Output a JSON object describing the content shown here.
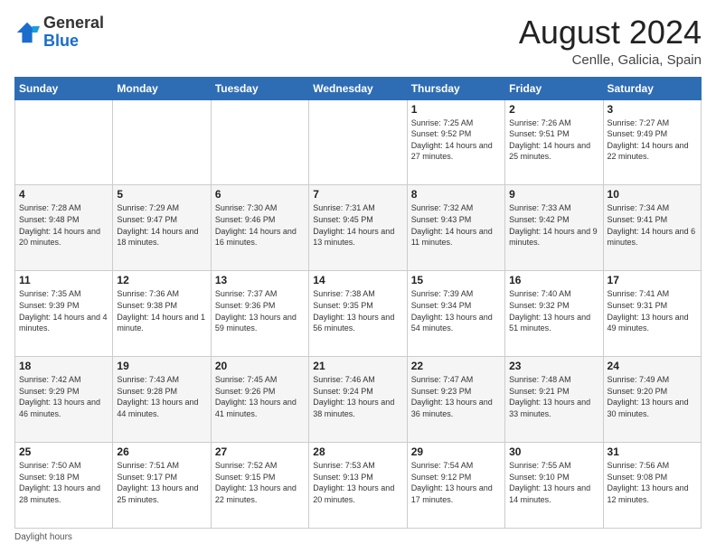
{
  "logo": {
    "general": "General",
    "blue": "Blue"
  },
  "header": {
    "month": "August 2024",
    "location": "Cenlle, Galicia, Spain"
  },
  "days_of_week": [
    "Sunday",
    "Monday",
    "Tuesday",
    "Wednesday",
    "Thursday",
    "Friday",
    "Saturday"
  ],
  "weeks": [
    [
      {
        "day": "",
        "info": ""
      },
      {
        "day": "",
        "info": ""
      },
      {
        "day": "",
        "info": ""
      },
      {
        "day": "",
        "info": ""
      },
      {
        "day": "1",
        "info": "Sunrise: 7:25 AM\nSunset: 9:52 PM\nDaylight: 14 hours and 27 minutes."
      },
      {
        "day": "2",
        "info": "Sunrise: 7:26 AM\nSunset: 9:51 PM\nDaylight: 14 hours and 25 minutes."
      },
      {
        "day": "3",
        "info": "Sunrise: 7:27 AM\nSunset: 9:49 PM\nDaylight: 14 hours and 22 minutes."
      }
    ],
    [
      {
        "day": "4",
        "info": "Sunrise: 7:28 AM\nSunset: 9:48 PM\nDaylight: 14 hours and 20 minutes."
      },
      {
        "day": "5",
        "info": "Sunrise: 7:29 AM\nSunset: 9:47 PM\nDaylight: 14 hours and 18 minutes."
      },
      {
        "day": "6",
        "info": "Sunrise: 7:30 AM\nSunset: 9:46 PM\nDaylight: 14 hours and 16 minutes."
      },
      {
        "day": "7",
        "info": "Sunrise: 7:31 AM\nSunset: 9:45 PM\nDaylight: 14 hours and 13 minutes."
      },
      {
        "day": "8",
        "info": "Sunrise: 7:32 AM\nSunset: 9:43 PM\nDaylight: 14 hours and 11 minutes."
      },
      {
        "day": "9",
        "info": "Sunrise: 7:33 AM\nSunset: 9:42 PM\nDaylight: 14 hours and 9 minutes."
      },
      {
        "day": "10",
        "info": "Sunrise: 7:34 AM\nSunset: 9:41 PM\nDaylight: 14 hours and 6 minutes."
      }
    ],
    [
      {
        "day": "11",
        "info": "Sunrise: 7:35 AM\nSunset: 9:39 PM\nDaylight: 14 hours and 4 minutes."
      },
      {
        "day": "12",
        "info": "Sunrise: 7:36 AM\nSunset: 9:38 PM\nDaylight: 14 hours and 1 minute."
      },
      {
        "day": "13",
        "info": "Sunrise: 7:37 AM\nSunset: 9:36 PM\nDaylight: 13 hours and 59 minutes."
      },
      {
        "day": "14",
        "info": "Sunrise: 7:38 AM\nSunset: 9:35 PM\nDaylight: 13 hours and 56 minutes."
      },
      {
        "day": "15",
        "info": "Sunrise: 7:39 AM\nSunset: 9:34 PM\nDaylight: 13 hours and 54 minutes."
      },
      {
        "day": "16",
        "info": "Sunrise: 7:40 AM\nSunset: 9:32 PM\nDaylight: 13 hours and 51 minutes."
      },
      {
        "day": "17",
        "info": "Sunrise: 7:41 AM\nSunset: 9:31 PM\nDaylight: 13 hours and 49 minutes."
      }
    ],
    [
      {
        "day": "18",
        "info": "Sunrise: 7:42 AM\nSunset: 9:29 PM\nDaylight: 13 hours and 46 minutes."
      },
      {
        "day": "19",
        "info": "Sunrise: 7:43 AM\nSunset: 9:28 PM\nDaylight: 13 hours and 44 minutes."
      },
      {
        "day": "20",
        "info": "Sunrise: 7:45 AM\nSunset: 9:26 PM\nDaylight: 13 hours and 41 minutes."
      },
      {
        "day": "21",
        "info": "Sunrise: 7:46 AM\nSunset: 9:24 PM\nDaylight: 13 hours and 38 minutes."
      },
      {
        "day": "22",
        "info": "Sunrise: 7:47 AM\nSunset: 9:23 PM\nDaylight: 13 hours and 36 minutes."
      },
      {
        "day": "23",
        "info": "Sunrise: 7:48 AM\nSunset: 9:21 PM\nDaylight: 13 hours and 33 minutes."
      },
      {
        "day": "24",
        "info": "Sunrise: 7:49 AM\nSunset: 9:20 PM\nDaylight: 13 hours and 30 minutes."
      }
    ],
    [
      {
        "day": "25",
        "info": "Sunrise: 7:50 AM\nSunset: 9:18 PM\nDaylight: 13 hours and 28 minutes."
      },
      {
        "day": "26",
        "info": "Sunrise: 7:51 AM\nSunset: 9:17 PM\nDaylight: 13 hours and 25 minutes."
      },
      {
        "day": "27",
        "info": "Sunrise: 7:52 AM\nSunset: 9:15 PM\nDaylight: 13 hours and 22 minutes."
      },
      {
        "day": "28",
        "info": "Sunrise: 7:53 AM\nSunset: 9:13 PM\nDaylight: 13 hours and 20 minutes."
      },
      {
        "day": "29",
        "info": "Sunrise: 7:54 AM\nSunset: 9:12 PM\nDaylight: 13 hours and 17 minutes."
      },
      {
        "day": "30",
        "info": "Sunrise: 7:55 AM\nSunset: 9:10 PM\nDaylight: 13 hours and 14 minutes."
      },
      {
        "day": "31",
        "info": "Sunrise: 7:56 AM\nSunset: 9:08 PM\nDaylight: 13 hours and 12 minutes."
      }
    ]
  ],
  "footer": {
    "note": "Daylight hours"
  }
}
